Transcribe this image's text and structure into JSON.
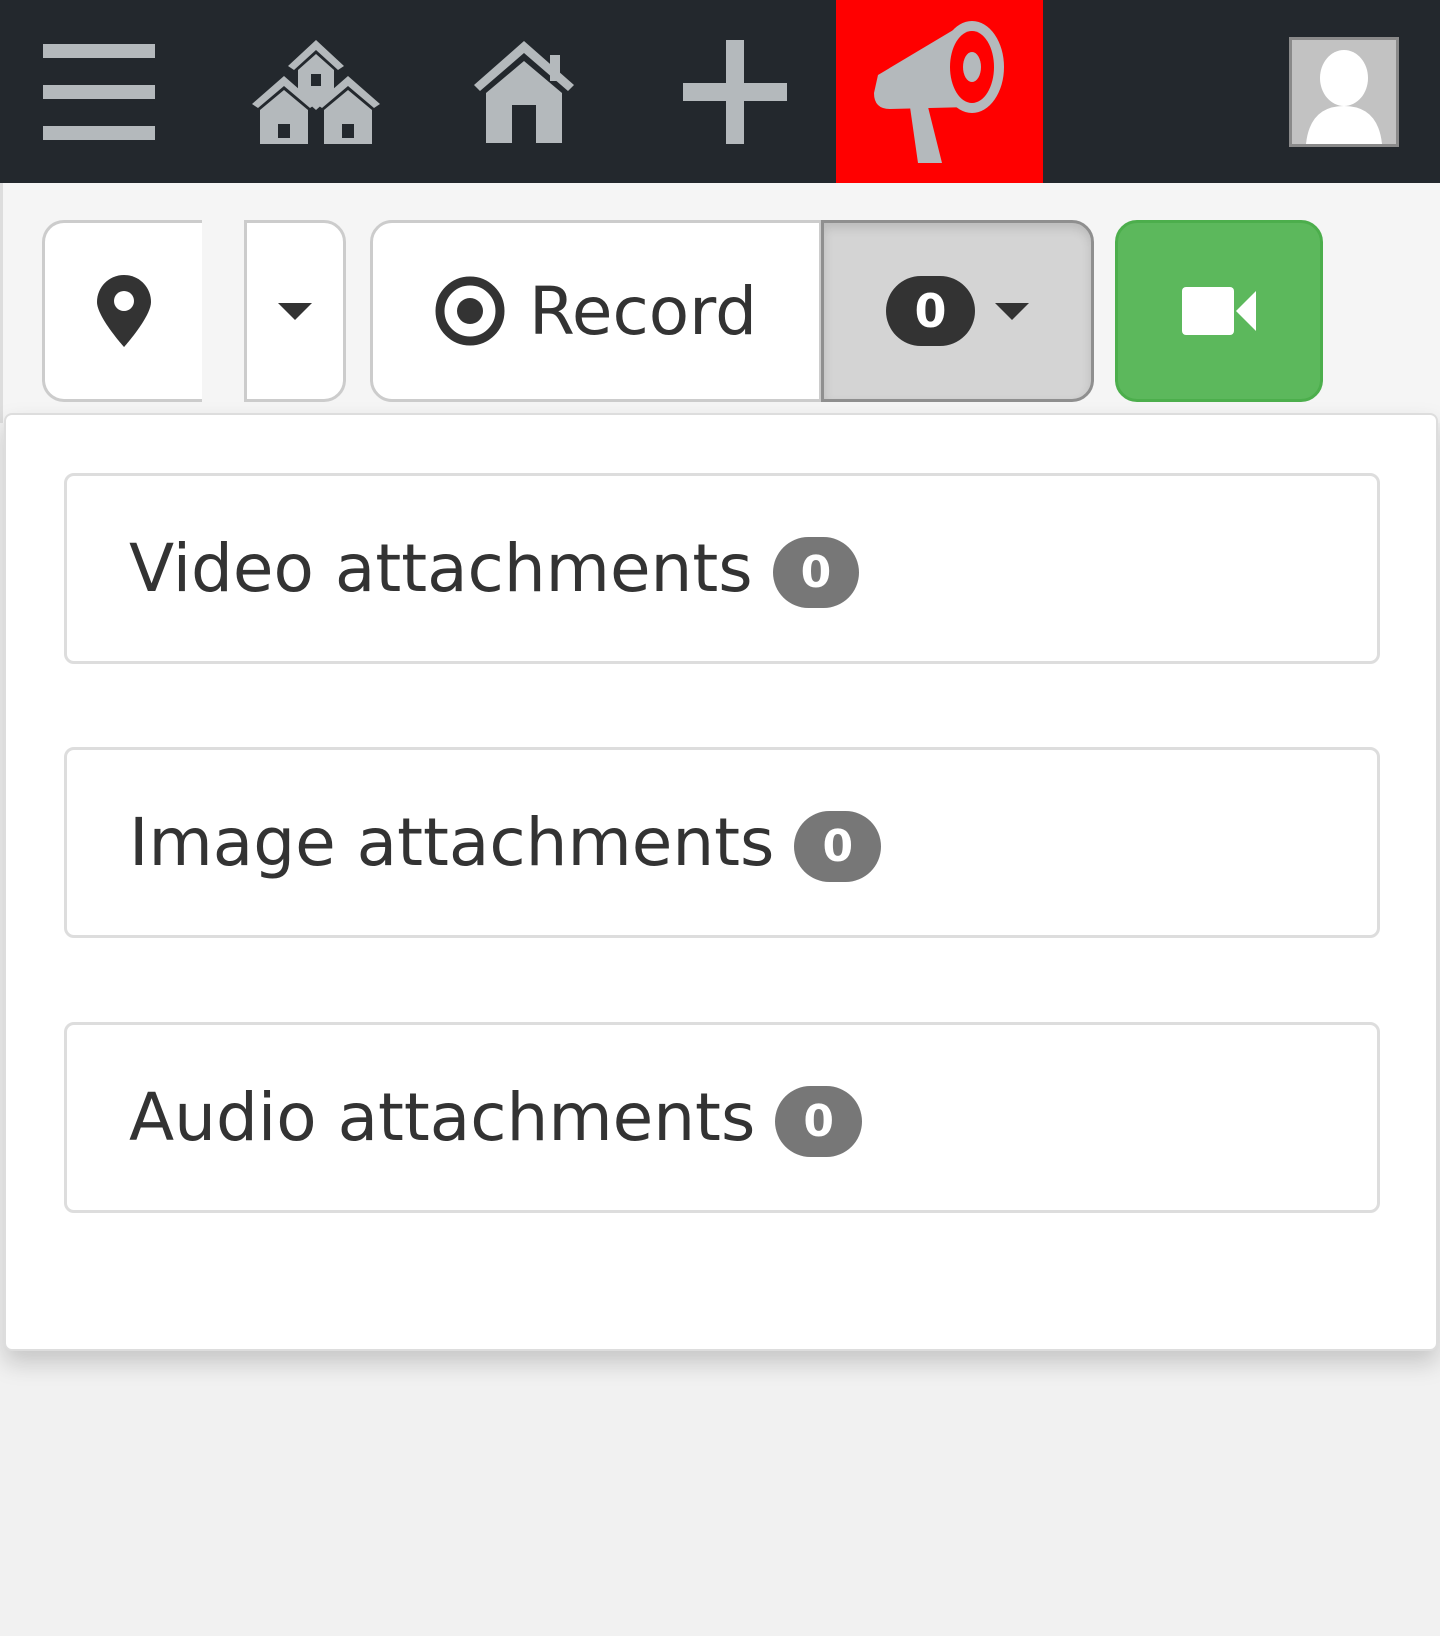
{
  "navbar": {
    "icons": [
      "menu-icon",
      "neighborhood-icon",
      "home-icon",
      "plus-icon",
      "megaphone-icon",
      "user-avatar-icon"
    ],
    "alert_color": "#ff0000"
  },
  "toolbar": {
    "location_icon": "map-marker-icon",
    "record_label": "Record",
    "record_count": "0",
    "camera_icon": "video-camera-icon",
    "camera_color": "#5cb85c"
  },
  "dropdown": {
    "items": [
      {
        "label": "Video attachments",
        "count": "0"
      },
      {
        "label": "Image attachments",
        "count": "0"
      },
      {
        "label": "Audio attachments",
        "count": "0"
      }
    ]
  }
}
